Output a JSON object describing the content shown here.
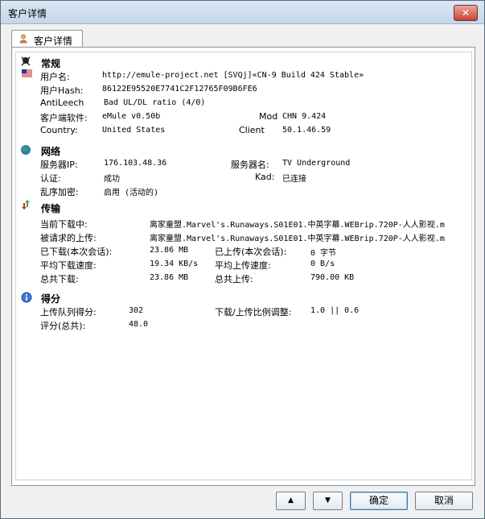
{
  "window": {
    "title": "客户详情",
    "close": "✕"
  },
  "tab": {
    "label": "客户详情"
  },
  "sections": {
    "general": "常规",
    "network": "网络",
    "transfer": "传输",
    "score": "得分"
  },
  "general": {
    "user_name_label": "用户名:",
    "user_name": "http://emule-project.net [SVQj]«CN-9 Build 424 Stable»",
    "user_hash_label": "用户Hash:",
    "user_hash": "86122E95520E7741C2F12765F09B6FE6",
    "antileech_label": "AntiLeech",
    "antileech": "Bad UL/DL ratio (4/0)",
    "client_label": "客户端软件:",
    "client": "eMule v0.50b",
    "mod_label": "Mod",
    "mod": "CHN 9.424",
    "country_label": "Country:",
    "country": "United States",
    "client_ip_label": "Client",
    "client_ip": "50.1.46.59"
  },
  "network": {
    "server_ip_label": "服务器IP:",
    "server_ip": "176.103.48.36",
    "server_name_label": "服务器名:",
    "server_name": "TV Underground",
    "auth_label": "认证:",
    "auth": "成功",
    "kad_label": "Kad:",
    "kad": "已连接",
    "obfuscation_label": "乱序加密:",
    "obfuscation": "启用 (活动的)"
  },
  "transfer": {
    "current_dl_label": "当前下载中:",
    "current_dl": "离家童盟.Marvel's.Runaways.S01E01.中英字幕.WEBrip.720P-人人影视.m",
    "requested_ul_label": "被请求的上传:",
    "requested_ul": "离家童盟.Marvel's.Runaways.S01E01.中英字幕.WEBrip.720P-人人影视.m",
    "session_dl_label": "已下载(本次会话):",
    "session_dl": "23.86 MB",
    "session_ul_label": "已上传(本次会话):",
    "session_ul": "0 字节",
    "avg_dl_label": "平均下载速度:",
    "avg_dl": "19.34 KB/s",
    "avg_ul_label": "平均上传速度:",
    "avg_ul": "0 B/s",
    "total_dl_label": "总共下载:",
    "total_dl": "23.86 MB",
    "total_ul_label": "总共上传:",
    "total_ul": "790.00 KB"
  },
  "score": {
    "queue_label": "上传队列得分:",
    "queue": "302",
    "ratio_label": "下载/上传比例调整:",
    "ratio": "1.0 || 0.6",
    "rating_label": "评分(总共):",
    "rating": "48.0"
  },
  "buttons": {
    "up": "▲",
    "down": "▼",
    "ok": "确定",
    "cancel": "取消"
  }
}
